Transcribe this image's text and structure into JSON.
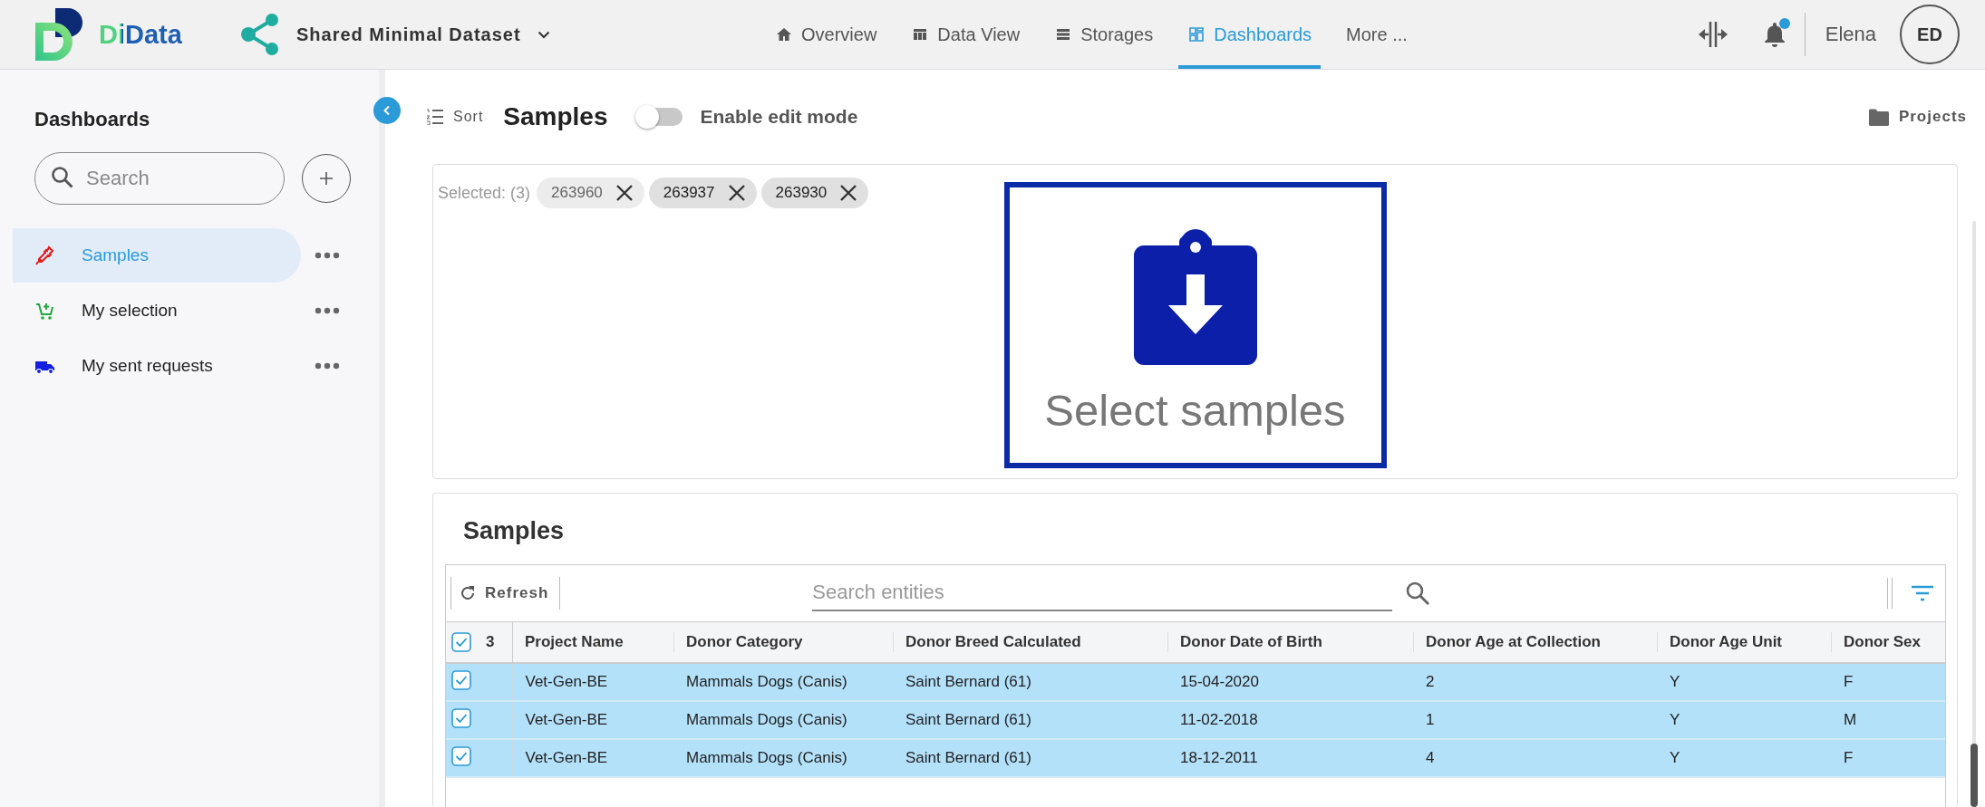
{
  "app": {
    "name": "DiData"
  },
  "dataset": {
    "title": "Shared Minimal Dataset"
  },
  "nav": [
    {
      "label": "Overview",
      "selected": false
    },
    {
      "label": "Data View",
      "selected": false
    },
    {
      "label": "Storages",
      "selected": false
    },
    {
      "label": "Dashboards",
      "selected": true
    },
    {
      "label": "More ...",
      "selected": false
    }
  ],
  "user": {
    "name": "Elena",
    "initials": "ED",
    "has_notification": true
  },
  "sidebar": {
    "title": "Dashboards",
    "search": {
      "placeholder": "Search"
    },
    "items": [
      {
        "label": "Samples",
        "selected": true
      },
      {
        "label": "My selection",
        "selected": false
      },
      {
        "label": "My sent requests",
        "selected": false
      }
    ]
  },
  "toolbar": {
    "sort": "Sort",
    "title": "Samples",
    "edit_mode": {
      "label": "Enable edit mode",
      "on": false
    },
    "projects": "Projects"
  },
  "selection": {
    "label": "Selected: (3)",
    "chips": [
      {
        "label": "263960",
        "dimmed": true
      },
      {
        "label": "263937",
        "dimmed": false
      },
      {
        "label": "263930",
        "dimmed": false
      }
    ],
    "drop_zone": "Select samples"
  },
  "table": {
    "title": "Samples",
    "refresh": "Refresh",
    "search": {
      "placeholder": "Search entities"
    },
    "all_checked": true,
    "selected_count": "3",
    "columns": [
      "Project Name",
      "Donor Category",
      "Donor Breed Calculated",
      "Donor Date of Birth",
      "Donor Age at Collection",
      "Donor Age Unit",
      "Donor Sex"
    ],
    "rows": [
      {
        "selected": true,
        "cells": [
          "Vet-Gen-BE",
          "Mammals Dogs (Canis)",
          "Saint Bernard (61)",
          "15-04-2020",
          "2",
          "Y",
          "F"
        ]
      },
      {
        "selected": true,
        "cells": [
          "Vet-Gen-BE",
          "Mammals Dogs (Canis)",
          "Saint Bernard (61)",
          "11-02-2018",
          "1",
          "Y",
          "M"
        ]
      },
      {
        "selected": true,
        "cells": [
          "Vet-Gen-BE",
          "Mammals Dogs (Canis)",
          "Saint Bernard (61)",
          "18-12-2011",
          "4",
          "Y",
          "F"
        ]
      }
    ]
  }
}
